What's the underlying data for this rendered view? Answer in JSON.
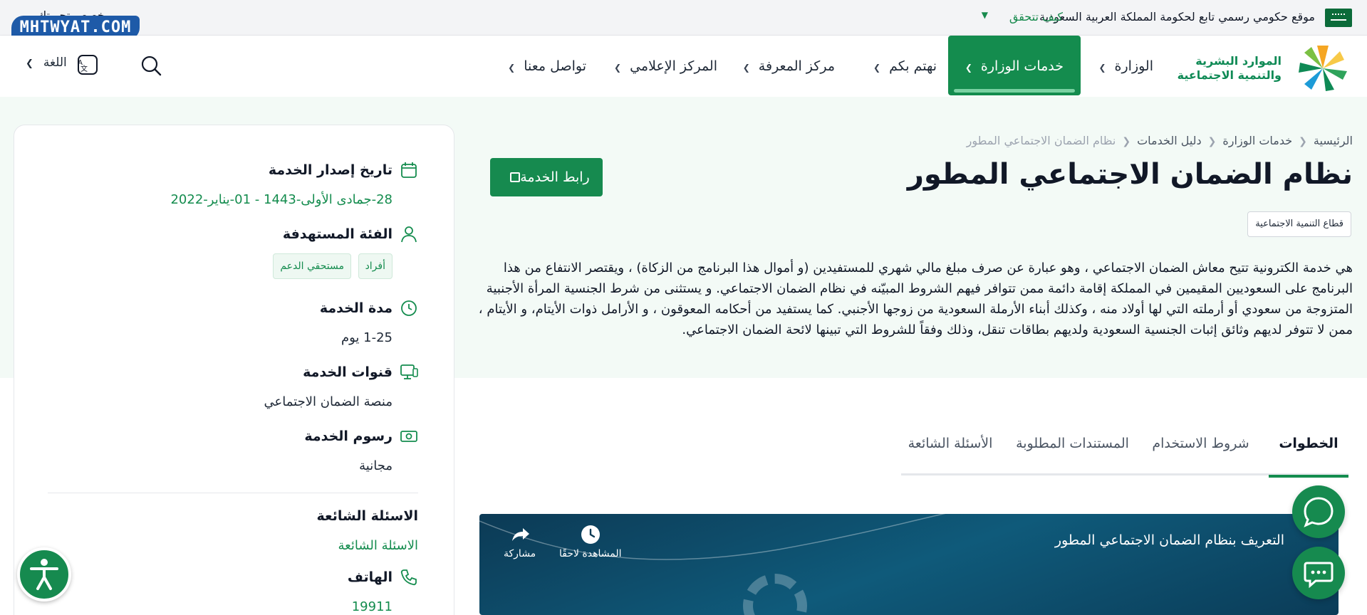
{
  "govbar": {
    "official_text": "موقع حكومي رسمي تابع لحكومة المملكة العربية السعودية",
    "verify_label": "كيف تتحقق",
    "special_label": "خصص تجربتك"
  },
  "watermark": "MHTWYAT.COM",
  "logo": {
    "line1": "الموارد البشرية",
    "line2": "والتنمية الاجتماعية"
  },
  "nav": {
    "items": [
      {
        "label": "الوزارة"
      },
      {
        "label": "خدمات الوزارة"
      },
      {
        "label": "نهتم بكم"
      },
      {
        "label": "مركز المعرفة"
      },
      {
        "label": "المركز الإعلامي"
      },
      {
        "label": "تواصل معنا"
      }
    ],
    "language_label": "اللغة"
  },
  "breadcrumb": [
    "الرئيسية",
    "خدمات الوزارة",
    "دليل الخدمات",
    "نظام الضمان الاجتماعي المطور"
  ],
  "page": {
    "title": "نظام الضمان الاجتماعي المطور",
    "service_link_label": "رابط الخدمة",
    "sector": "قطاع التنمية الاجتماعية",
    "description": "هي خدمة الكترونية تتيح معاش الضمان الاجتماعي ، وهو عبارة عن صرف مبلغ مالي شهري للمستفيدين (و أموال هذا البرنامج من الزكاة) ، ويقتصر الانتفاع من هذا البرنامج على السعوديين المقيمين في المملكة إقامة دائمة ممن تتوافر فيهم الشروط المبيّنه في نظام الضمان الاجتماعي. و يستثنى من شرط الجنسية المرأة الأجنبية المتزوجة من سعودي أو أرملته التي لها أولاد منه ، وكذلك أبناء الأرملة السعودية من زوجها الأجنبي. كما يستفيد من أحكامه المعوقون ، و الأرامل ذوات الأيتام، و الأيتام ، ممن لا تتوفر لديهم وثائق إثبات الجنسية السعودية ولديهم بطاقات تنقل، وذلك وفقاً للشروط التي تبينها لائحة الضمان الاجتماعي."
  },
  "tabs": [
    {
      "label": "الخطوات"
    },
    {
      "label": "شروط الاستخدام"
    },
    {
      "label": "المستندات المطلوبة"
    },
    {
      "label": "الأسئلة الشائعة"
    }
  ],
  "video": {
    "title": "التعريف بنظام الضمان الاجتماعي المطور",
    "watch_later": "المشاهدة لاحقًا",
    "share": "مشاركة"
  },
  "details": {
    "release_title": "تاريخ إصدار الخدمة",
    "release_value": "28-جمادى الأولى-1443 - 01-يناير-2022",
    "audience_title": "الفئة المستهدفة",
    "audience_chips": [
      "أفراد",
      "مستحقي الدعم"
    ],
    "duration_title": "مدة الخدمة",
    "duration_value": "1-25 يوم",
    "channels_title": "قنوات الخدمة",
    "channels_value": "منصة الضمان الاجتماعي",
    "fees_title": "رسوم الخدمة",
    "fees_value": "مجانية",
    "faq_title": "الاسئلة الشائعة",
    "faq_link": "الاسئلة الشائعة",
    "phone_title": "الهاتف",
    "phone_value": "19911"
  },
  "colors": {
    "brand_green": "#148c4e",
    "hero_bg": "#f3faf6",
    "watermark_blue": "#1e5aa8"
  }
}
